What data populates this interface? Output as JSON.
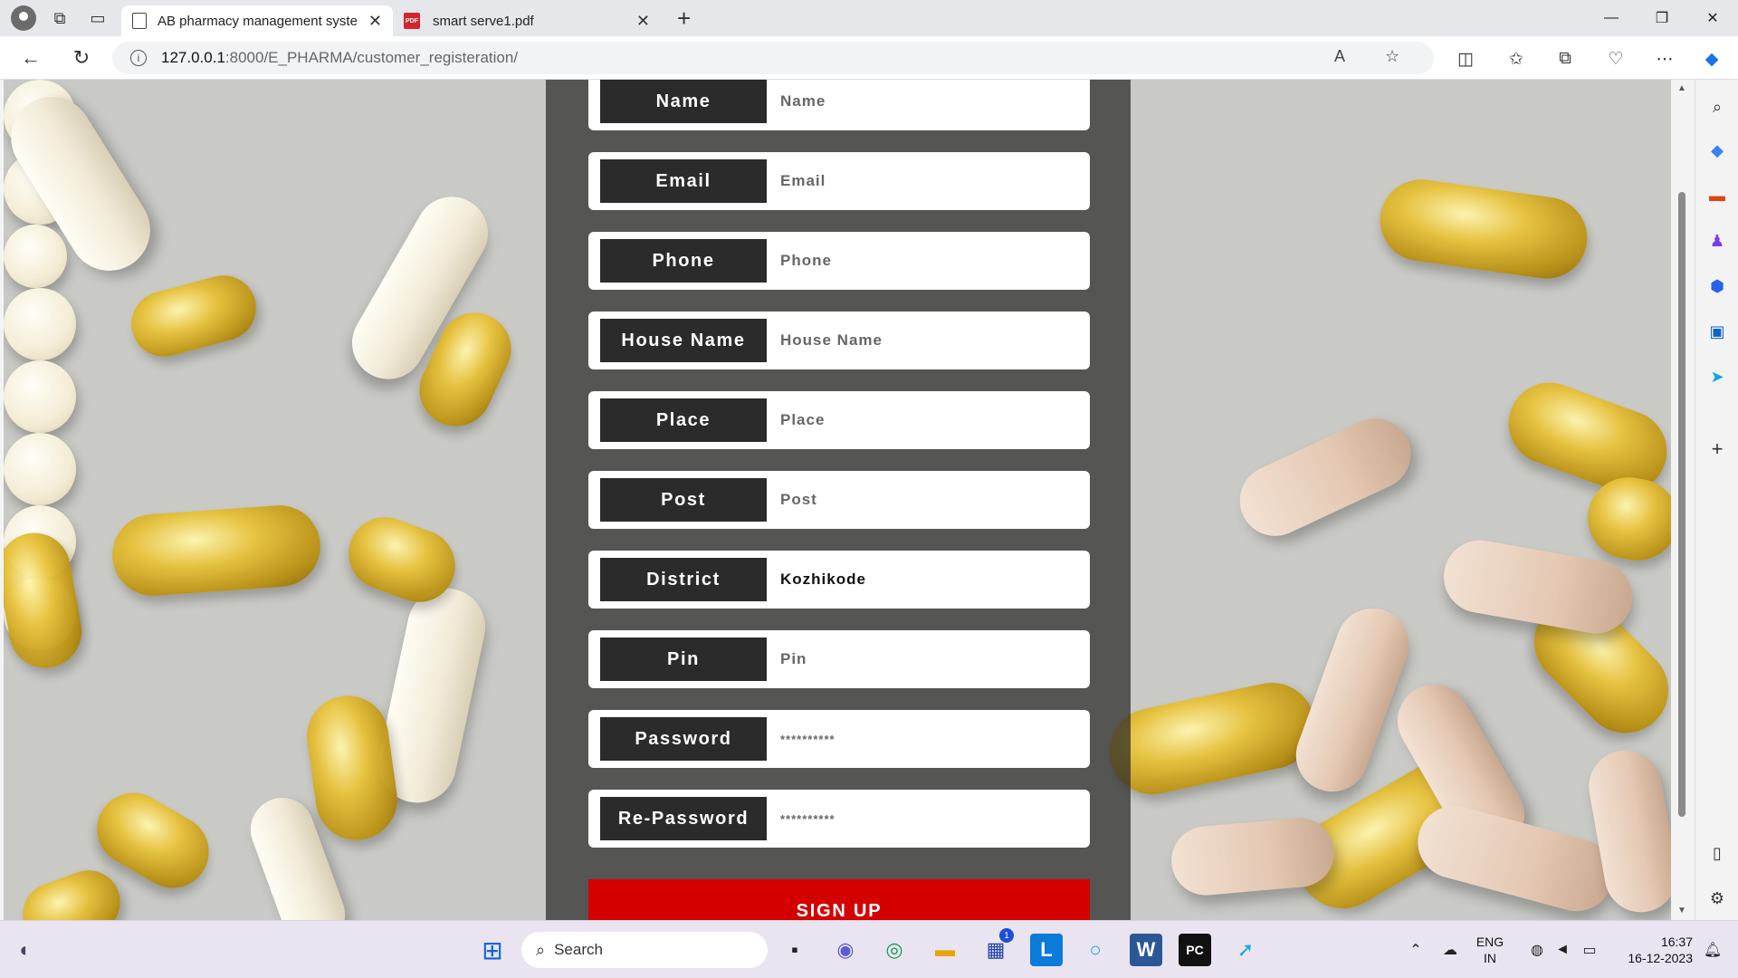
{
  "browser": {
    "tabs": [
      {
        "title": "AB pharmacy management syste",
        "active": true
      },
      {
        "title": "smart serve1.pdf",
        "active": false
      }
    ],
    "address": {
      "host": "127.0.0.1",
      "path": ":8000/E_PHARMA/customer_registeration/"
    },
    "icons": {
      "back": "arrow-left-icon",
      "refresh": "refresh-icon",
      "info": "info-icon",
      "read_aloud": "read-aloud-icon",
      "favorite": "star-icon",
      "split": "split-screen-icon",
      "favorites": "favorites-icon",
      "collections": "collections-icon",
      "health": "browser-essentials-icon",
      "more": "more-icon",
      "copilot": "copilot-icon"
    },
    "pdf_badge": "PDF"
  },
  "form": {
    "fields": [
      {
        "label": "Name",
        "placeholder": "Name",
        "value": ""
      },
      {
        "label": "Email",
        "placeholder": "Email",
        "value": ""
      },
      {
        "label": "Phone",
        "placeholder": "Phone",
        "value": ""
      },
      {
        "label": "House Name",
        "placeholder": "House Name",
        "value": ""
      },
      {
        "label": "Place",
        "placeholder": "Place",
        "value": ""
      },
      {
        "label": "Post",
        "placeholder": "Post",
        "value": ""
      },
      {
        "label": "District",
        "placeholder": "",
        "value": "Kozhikode"
      },
      {
        "label": "Pin",
        "placeholder": "Pin",
        "value": ""
      },
      {
        "label": "Password",
        "placeholder": "**********",
        "value": ""
      },
      {
        "label": "Re-Password",
        "placeholder": "**********",
        "value": ""
      }
    ],
    "submit_label": "SIGN UP"
  },
  "taskbar": {
    "search_label": "Search",
    "lang_line1": "ENG",
    "lang_line2": "IN",
    "time": "16:37",
    "date": "16-12-2023",
    "store_badge": "1"
  },
  "colors": {
    "accent": "#d40000",
    "label_bg": "#2b2b2b",
    "panel": "#282828"
  }
}
